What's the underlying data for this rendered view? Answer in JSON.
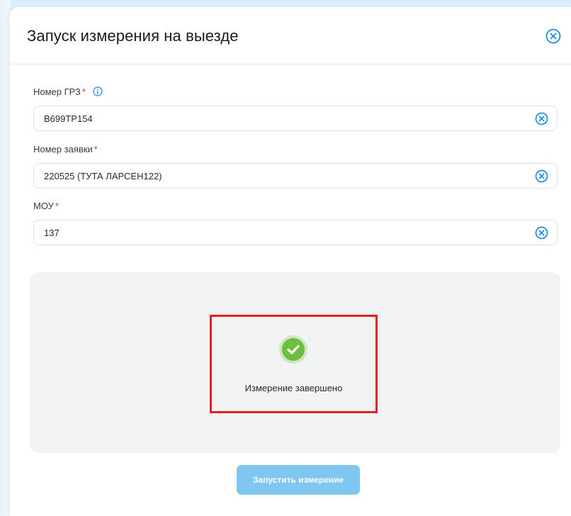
{
  "modal": {
    "title": "Запуск измерения на выезде"
  },
  "fields": [
    {
      "label": "Номер ГРЗ",
      "value": "В699ТР154",
      "required_mark": "*"
    },
    {
      "label": "Номер заявки",
      "value": "220525 (ТУТА ЛАРСЕН122)",
      "required_mark": "*"
    },
    {
      "label": "МОУ",
      "value": "137",
      "required_mark": "*"
    }
  ],
  "status": {
    "text": "Измерение завершено",
    "icon": "check-circle-icon",
    "color": "#6cbf3f"
  },
  "actions": {
    "start_label": "Запустить измерение"
  },
  "colors": {
    "accent": "#1e88e5",
    "required": "#e53935",
    "highlight": "#e61e1e",
    "button_disabled": "#7fc6f1"
  }
}
